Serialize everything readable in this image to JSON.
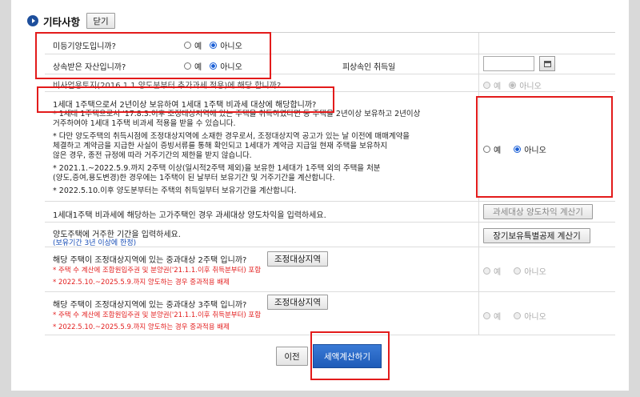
{
  "header": {
    "title": "기타사항",
    "close_label": "닫기"
  },
  "rows": {
    "q1": {
      "label": "미등기양도입니까?",
      "yes": "예",
      "no": "아니오",
      "selected": "no"
    },
    "q2": {
      "label": "상속받은 자산입니까?",
      "yes": "예",
      "no": "아니오",
      "selected": "no",
      "date_label": "피상속인 취득일",
      "date_value": ""
    },
    "q3": {
      "label": "비사업용토지(2016.1.1 양도분부터 추가과세 적용)에 해당 합니까?",
      "yes": "예",
      "no": "아니오",
      "selected": "no"
    },
    "q4": {
      "label": "1세대 1주택으로서 2년이상 보유하여 1세대 1주택 비과세 대상에 해당합니까?",
      "notes": [
        "* 1세대 1주택으로서 '17.8.3.이후 조정대상지역에 있는 주택을 취득하였다면 동 주택을 2년이상 보유하고 2년이상",
        "거주하여야 1세대 1주택 비과세 적용을 받을 수 있습니다.",
        "* 다만 양도주택의 취득시점에 조정대상지역에 소재한 경우로서, 조정대상지역 공고가 있는 날 이전에 매매계약을",
        "체결하고 계약금을 지급한 사실이 증빙서류를 통해 확인되고 1세대가 계약금 지급일 현재 주택을 보유하지",
        "않은 경우, 종전 규정에 따라 거주기간의 제한을 받지 않습니다.",
        "* 2021.1.~2022.5.9.까지 2주택 이상(일시적2주택 제외)을 보유한 1세대가 1주택 외의 주택을 처분",
        "(양도,증여,용도변경)한 경우에는 1주택이 된 날부터 보유기간 및 거주기간을 계산합니다.",
        "* 2022.5.10.이후 양도분부터는 주택의 취득일부터 보유기간을 계산합니다."
      ],
      "yes": "예",
      "no": "아니오",
      "selected": "no"
    },
    "q5": {
      "label": "1세대1주택 비과세에 해당하는 고가주택인 경우 과세대상 양도차익을 입력하세요.",
      "button": "과세대상 양도차익 계산기"
    },
    "q6": {
      "label": "양도주택에 거주한 기간을 입력하세요.",
      "sub": "(보유기간 3년 이상에 한정)",
      "button": "장기보유특별공제 계산기"
    },
    "q7": {
      "label": "해당 주택이 조정대상지역에 있는 중과대상 2주택 입니까?",
      "button": "조정대상지역",
      "note1": "* 주택 수 계산에 조합원입주권 및 분양권('21.1.1.이후 취득분부터) 포함",
      "note2": "* 2022.5.10.~2025.5.9.까지 양도하는 경우 중과적용 배제",
      "yes": "예",
      "no": "아니오",
      "selected": "no"
    },
    "q8": {
      "label": "해당 주택이 조정대상지역에 있는 중과대상 3주택 입니까?",
      "button": "조정대상지역",
      "note1": "* 주택 수 계산에 조합원입주권 및 분양권('21.1.1.이후 취득분부터) 포함",
      "note2": "* 2022.5.10.~2025.5.9.까지 양도하는 경우 중과적용 배제",
      "yes": "예",
      "no": "아니오",
      "selected": "no"
    }
  },
  "footer": {
    "prev_label": "이전",
    "calc_label": "세액계산하기"
  },
  "colors": {
    "accent": "#1e4f9c",
    "highlight": "#e31b1b",
    "primary_button": "#1e5bb8"
  }
}
